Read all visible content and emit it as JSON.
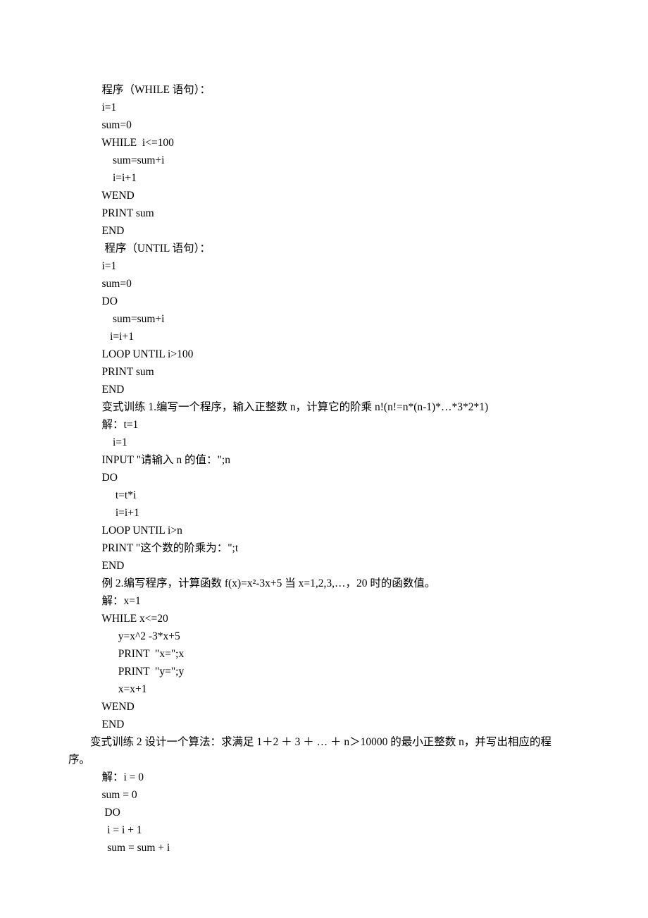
{
  "lines": [
    {
      "cls": "line",
      "text": "    程序（WHILE 语句）："
    },
    {
      "cls": "line",
      "text": "    i=1"
    },
    {
      "cls": "line",
      "text": "    sum=0"
    },
    {
      "cls": "line",
      "text": "    WHILE  i<=100"
    },
    {
      "cls": "line",
      "text": "        sum=sum+i"
    },
    {
      "cls": "line",
      "text": "        i=i+1"
    },
    {
      "cls": "line",
      "text": "    WEND"
    },
    {
      "cls": "line",
      "text": "    PRINT sum"
    },
    {
      "cls": "line",
      "text": "    END"
    },
    {
      "cls": "line",
      "text": "     程序（UNTIL 语句）："
    },
    {
      "cls": "line",
      "text": "    i=1"
    },
    {
      "cls": "line",
      "text": "    sum=0"
    },
    {
      "cls": "line",
      "text": "    DO"
    },
    {
      "cls": "line",
      "text": "        sum=sum+i"
    },
    {
      "cls": "line",
      "text": "       i=i+1"
    },
    {
      "cls": "line",
      "text": "    LOOP UNTIL i>100"
    },
    {
      "cls": "line",
      "text": "    PRINT sum"
    },
    {
      "cls": "line",
      "text": "    END"
    },
    {
      "cls": "line",
      "text": "    变式训练 1.编写一个程序，输入正整数 n，计算它的阶乘 n!(n!=n*(n-1)*…*3*2*1)"
    },
    {
      "cls": "line",
      "text": "    解：t=1"
    },
    {
      "cls": "line",
      "text": "        i=1"
    },
    {
      "cls": "line",
      "text": "    INPUT \"请输入 n 的值：\";n"
    },
    {
      "cls": "line",
      "text": "    DO"
    },
    {
      "cls": "line",
      "text": "         t=t*i"
    },
    {
      "cls": "line",
      "text": "         i=i+1"
    },
    {
      "cls": "line",
      "text": "    LOOP UNTIL i>n"
    },
    {
      "cls": "line",
      "text": "    PRINT \"这个数的阶乘为：\";t"
    },
    {
      "cls": "line",
      "text": "    END"
    },
    {
      "cls": "line",
      "text": "    例 2.编写程序，计算函数 f(x)=x²-3x+5 当 x=1,2,3,…，20 时的函数值。"
    },
    {
      "cls": "line",
      "text": "    解：x=1"
    },
    {
      "cls": "line",
      "text": "    WHILE x<=20"
    },
    {
      "cls": "line",
      "text": "          y=x^2 -3*x+5"
    },
    {
      "cls": "line",
      "text": "          PRINT  \"x=\";x"
    },
    {
      "cls": "line",
      "text": "          PRINT  \"y=\";y"
    },
    {
      "cls": "line",
      "text": "          x=x+1"
    },
    {
      "cls": "line",
      "text": "    WEND"
    },
    {
      "cls": "line",
      "text": "    END"
    },
    {
      "cls": "outdent",
      "text": "　　变式训练 2 设计一个算法：求满足 1＋2 ＋ 3 ＋ … ＋ n＞10000 的最小正整数 n，并写出相应的程序。"
    },
    {
      "cls": "line",
      "text": "    解：i = 0"
    },
    {
      "cls": "line",
      "text": "    sum = 0"
    },
    {
      "cls": "line",
      "text": "     DO"
    },
    {
      "cls": "line",
      "text": "      i = i + 1"
    },
    {
      "cls": "line",
      "text": "      sum = sum + i"
    }
  ]
}
